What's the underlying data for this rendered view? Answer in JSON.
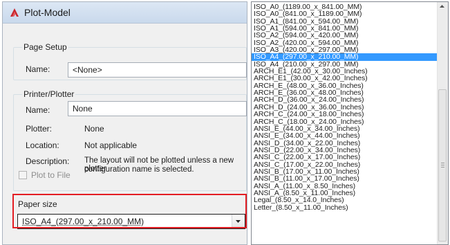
{
  "dialog": {
    "title": "Plot-Model",
    "page_setup": {
      "group_label": "Page Setup",
      "name_label": "Name:",
      "name_value": "<None>"
    },
    "printer": {
      "group_label": "Printer/Plotter",
      "name_label": "Name:",
      "name_value": "None",
      "plotter_label": "Plotter:",
      "plotter_value": "None",
      "location_label": "Location:",
      "location_value": "Not applicable",
      "description_label": "Description:",
      "description_line1": "The layout will not be plotted unless a new plotter",
      "description_line2": "configuration name is selected.",
      "plot_to_file_label": "Plot to File"
    },
    "paper_size": {
      "group_label": "Paper size",
      "value": "ISO_A4_(297.00_x_210.00_MM)"
    }
  },
  "dropdown": {
    "selected_index": 7,
    "items": [
      "ISO_A0_(1189.00_x_841.00_MM)",
      "ISO_A0_(841.00_x_1189.00_MM)",
      "ISO_A1_(841.00_x_594.00_MM)",
      "ISO_A1_(594.00_x_841.00_MM)",
      "ISO_A2_(594.00_x_420.00_MM)",
      "ISO_A2_(420.00_x_594.00_MM)",
      "ISO_A3_(420.00_x_297.00_MM)",
      "ISO_A4_(297.00_x_210.00_MM)",
      "ISO_A4_(210.00_x_297.00_MM)",
      "ARCH_E1_(42.00_x_30.00_Inches)",
      "ARCH_E1_(30.00_x_42.00_Inches)",
      "ARCH_E_(48.00_x_36.00_Inches)",
      "ARCH_E_(36.00_x_48.00_Inches)",
      "ARCH_D_(36.00_x_24.00_Inches)",
      "ARCH_D_(24.00_x_36.00_Inches)",
      "ARCH_C_(24.00_x_18.00_Inches)",
      "ARCH_C_(18.00_x_24.00_Inches)",
      "ANSI_E_(44.00_x_34.00_Inches)",
      "ANSI_E_(34.00_x_44.00_Inches)",
      "ANSI_D_(34.00_x_22.00_Inches)",
      "ANSI_D_(22.00_x_34.00_Inches)",
      "ANSI_C_(22.00_x_17.00_Inches)",
      "ANSI_C_(17.00_x_22.00_Inches)",
      "ANSI_B_(17.00_x_11.00_Inches)",
      "ANSI_B_(11.00_x_17.00_Inches)",
      "ANSI_A_(11.00_x_8.50_Inches)",
      "ANSI_A_(8.50_x_11.00_Inches)",
      "Legal_(8.50_x_14.0_Inches)",
      "Letter_(8.50_x_11.00_Inches)"
    ]
  },
  "colors": {
    "selection": "#3399ff",
    "highlight_border": "#e31d23",
    "titlebar": "#c9d9ec"
  },
  "icons": {
    "app": "autocad-app-icon",
    "combo_arrow": "chevron-down-icon",
    "scroll_up": "scroll-up-arrow-icon",
    "scroll_grip": "scroll-grip-icon"
  }
}
